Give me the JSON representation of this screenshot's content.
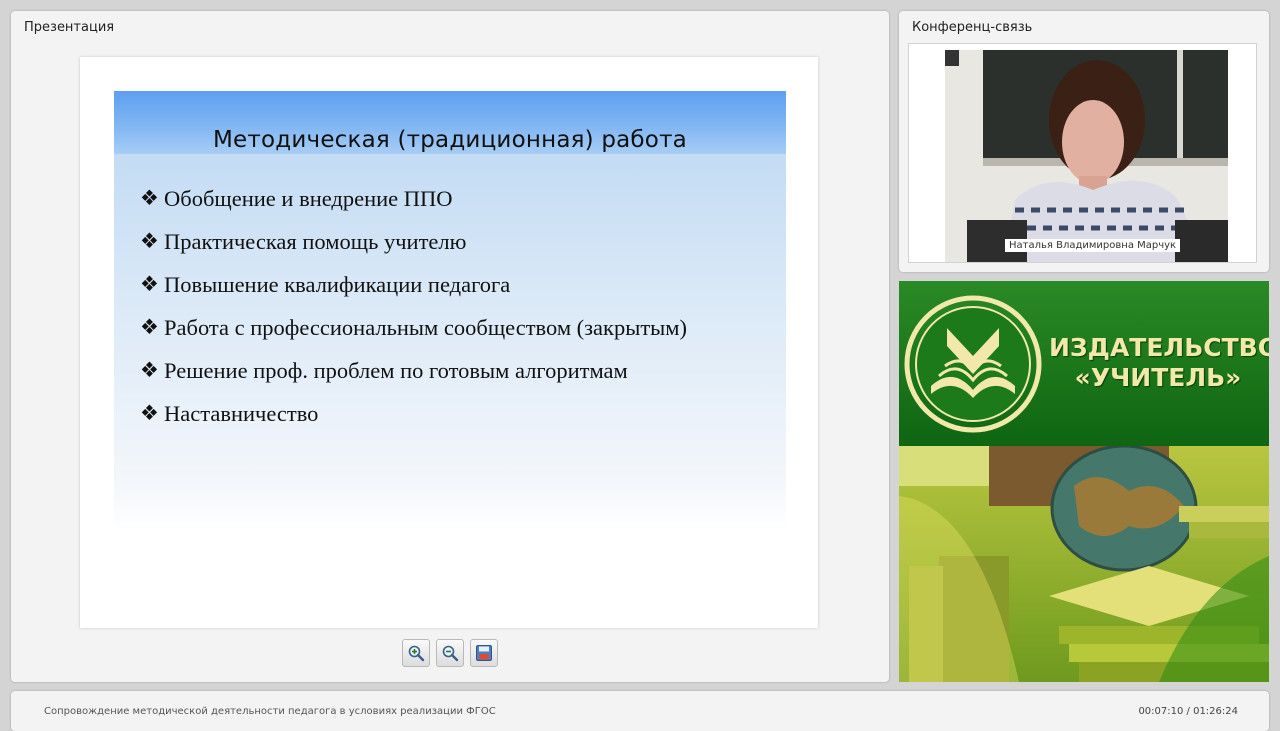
{
  "presentation": {
    "panel_title": "Презентация",
    "slide": {
      "title": "Методическая (традиционная) работа",
      "bullet_marker": "❖",
      "bullets": [
        "Обобщение и внедрение ППО",
        "Практическая помощь учителю",
        "Повышение квалификации педагога",
        "Работа с профессиональным сообществом (закрытым)",
        "Решение проф. проблем по готовым алгоритмам",
        "Наставничество"
      ]
    },
    "toolbar": {
      "zoom_in_icon": "zoom-in-icon",
      "zoom_out_icon": "zoom-out-icon",
      "save_icon": "floppy-disk-icon"
    }
  },
  "conference": {
    "panel_title": "Конференц-связь",
    "speaker_name": "Наталья Владимировна Марчук"
  },
  "banner": {
    "publisher_line1": "ИЗДАТЕЛЬСТВО",
    "publisher_line2": "«УЧИТЕЛЬ»",
    "logo_icon": "open-book-emblem-icon"
  },
  "footer": {
    "course_title": "Сопровождение методической деятельности педагога в условиях реализации ФГОС",
    "time": "00:07:10 / 01:26:24"
  },
  "colors": {
    "slide_header": "#5e9ff0",
    "banner_green": "#1f7a1c",
    "publisher_text": "#f2e8a9"
  }
}
